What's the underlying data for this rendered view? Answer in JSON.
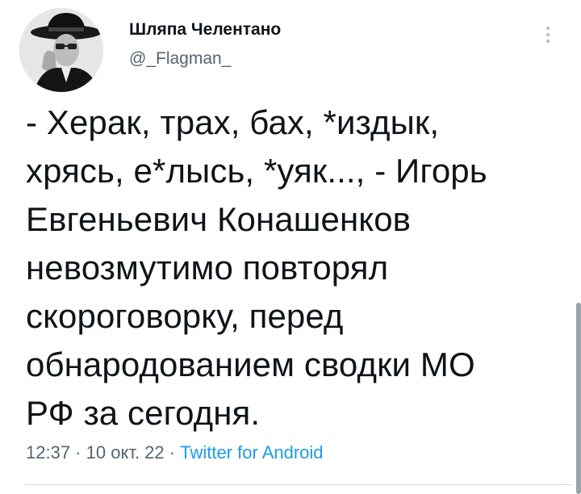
{
  "author": {
    "display_name": "Шляпа Челентано",
    "handle": "@_Flagman_",
    "avatar_icon": "avatar-photo-man-in-hat"
  },
  "tweet": {
    "lines": [
      "- Херак, трах, бах, *издык,",
      "хрясь, е*лысь, *уяк..., - Игорь",
      "Евгеньевич Конашенков",
      "невозмутимо повторял",
      "скороговорку, перед",
      "обнародованием сводки МО",
      "РФ за сегодня."
    ]
  },
  "meta": {
    "time": "12:37",
    "separator": " · ",
    "date": "10 окт. 22",
    "source": "Twitter for Android"
  },
  "menu": {
    "icon": "more-vertical-icon"
  },
  "colors": {
    "text_primary": "#0f1419",
    "text_secondary": "#536471",
    "link": "#1d9bf0",
    "divider": "#cfd9de"
  }
}
